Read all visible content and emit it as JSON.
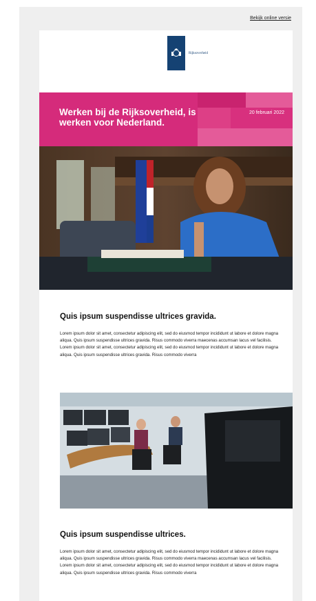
{
  "header": {
    "online_link": "Bekijk online versie"
  },
  "logo": {
    "brand_name": "Rijksoverheid"
  },
  "banner": {
    "title": "Werken bij de Rijksoverheid, is werken voor Nederland.",
    "date": "20 februari 2022",
    "color": "#d52b7b"
  },
  "sections": [
    {
      "heading": "Quis ipsum suspendisse ultrices gravida.",
      "body": "Lorem ipsum dolor sit amet, consectetur adipiscing elit, sed do eiusmod tempor incididunt ut labore et dolore magna aliqua. Quis ipsum suspendisse ultrices gravida. Risus commodo viverra maecenas accumsan lacus vel facilisis. Lorem ipsum dolor sit amet, consectetur adipiscing elit, sed do eiusmod tempor incididunt ut labore et dolore magna aliqua. Quis ipsum suspendisse ultrices gravida. Risus commodo viverra"
    },
    {
      "heading": "Quis ipsum suspendisse ultrices.",
      "body": "Lorem ipsum dolor sit amet, consectetur adipiscing elit, sed do eiusmod tempor incididunt ut labore et dolore magna aliqua. Quis ipsum suspendisse ultrices gravida. Risus commodo viverra maecenas accumsan lacus vel facilisis. Lorem ipsum dolor sit amet, consectetur adipiscing elit, sed do eiusmod tempor incididunt ut labore et dolore magna aliqua. Quis ipsum suspendisse ultrices gravida. Risus commodo viverra"
    }
  ]
}
